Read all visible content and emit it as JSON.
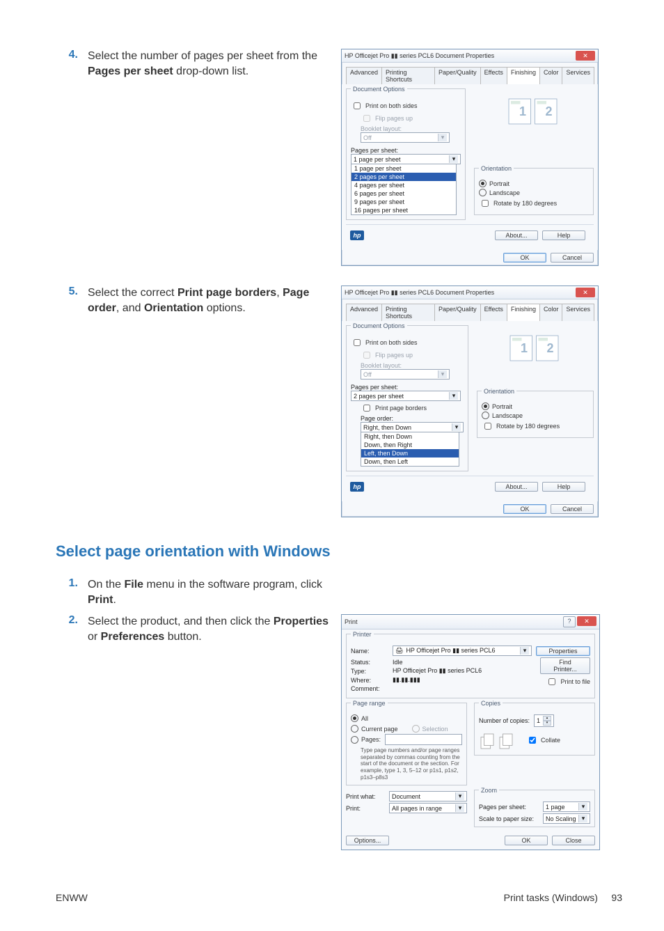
{
  "steps_top": [
    {
      "num": "4.",
      "html": "Select the number of pages per sheet from the <b>Pages per sheet</b> drop-down list."
    },
    {
      "num": "5.",
      "html": "Select the correct <b>Print page borders</b>, <b>Page order</b>, and <b>Orientation</b> options."
    }
  ],
  "section_heading": "Select page orientation with Windows",
  "steps_bottom": [
    {
      "num": "1.",
      "html": "On the <b>File</b> menu in the software program, click <b>Print</b>."
    },
    {
      "num": "2.",
      "html": "Select the product, and then click the <b>Properties</b> or <b>Preferences</b> button."
    }
  ],
  "dlg_props": {
    "title": "HP Officejet Pro ▮▮ series PCL6 Document Properties",
    "tabs": [
      "Advanced",
      "Printing Shortcuts",
      "Paper/Quality",
      "Effects",
      "Finishing",
      "Color",
      "Services"
    ],
    "active_tab": "Finishing",
    "doc_options_title": "Document Options",
    "print_both_sides": "Print on both sides",
    "flip_pages_up": "Flip pages up",
    "booklet_layout": "Booklet layout:",
    "booklet_value": "Off",
    "pages_per_sheet_label": "Pages per sheet:",
    "pps_value_1": "1 page per sheet",
    "pps_options": [
      "1 page per sheet",
      "2 pages per sheet",
      "4 pages per sheet",
      "6 pages per sheet",
      "9 pages per sheet",
      "16 pages per sheet"
    ],
    "pps_highlight": "2 pages per sheet",
    "pps_value_2": "2 pages per sheet",
    "print_page_borders": "Print page borders",
    "page_order_label": "Page order:",
    "page_order_value": "Right, then Down",
    "page_order_options": [
      "Right, then Down",
      "Down, then Right",
      "Left, then Down",
      "Down, then Left"
    ],
    "page_order_highlight": "Left, then Down",
    "orientation_title": "Orientation",
    "portrait": "Portrait",
    "landscape": "Landscape",
    "rotate180": "Rotate by 180 degrees",
    "about": "About...",
    "help": "Help",
    "ok": "OK",
    "cancel": "Cancel"
  },
  "dlg_print": {
    "title": "Print",
    "printer_grp": "Printer",
    "name_label": "Name:",
    "name_value": "HP Officejet Pro ▮▮ series PCL6",
    "properties_btn": "Properties",
    "find_printer_btn": "Find Printer...",
    "print_to_file": "Print to file",
    "status_label": "Status:",
    "status_value": "Idle",
    "type_label": "Type:",
    "type_value": "HP Officejet Pro ▮▮ series PCL6",
    "where_label": "Where:",
    "where_value": "▮▮.▮▮.▮▮▮",
    "comment_label": "Comment:",
    "page_range_grp": "Page range",
    "all": "All",
    "current_page": "Current page",
    "pages_radio": "Pages:",
    "selection": "Selection",
    "pages_help": "Type page numbers and/or page ranges separated by commas counting from the start of the document or the section. For example, type 1, 3, 5–12 or p1s1, p1s2, p1s3–p8s3",
    "copies_grp": "Copies",
    "num_copies_label": "Number of copies:",
    "num_copies_value": "1",
    "collate": "Collate",
    "print_what_label": "Print what:",
    "print_what_value": "Document",
    "print_label": "Print:",
    "print_value": "All pages in range",
    "zoom_grp": "Zoom",
    "zoom_pps_label": "Pages per sheet:",
    "zoom_pps_value": "1 page",
    "zoom_scale_label": "Scale to paper size:",
    "zoom_scale_value": "No Scaling",
    "options_btn": "Options...",
    "ok": "OK",
    "close": "Close"
  },
  "footer": {
    "left": "ENWW",
    "right_label": "Print tasks (Windows)",
    "page_num": "93"
  }
}
